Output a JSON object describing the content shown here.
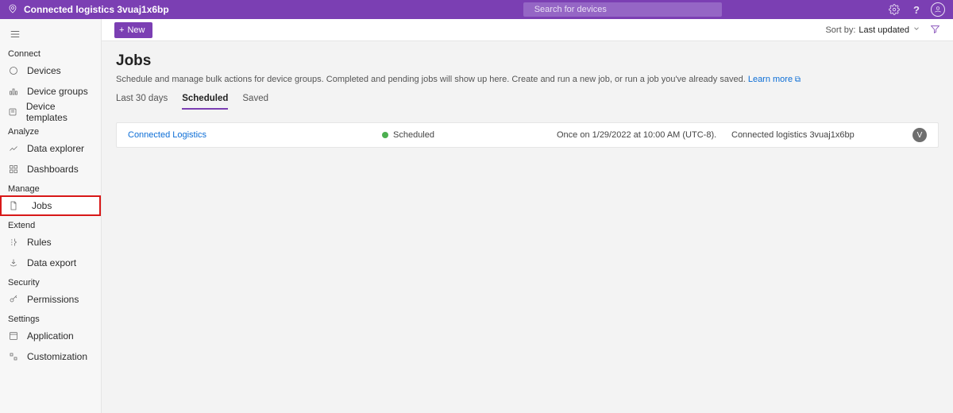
{
  "header": {
    "app_title": "Connected logistics 3vuaj1x6bp",
    "search_placeholder": "Search for devices"
  },
  "sidebar": {
    "groups": [
      {
        "label": "Connect",
        "items": [
          {
            "icon": "devices",
            "label": "Devices"
          },
          {
            "icon": "device-groups",
            "label": "Device groups"
          },
          {
            "icon": "templates",
            "label": "Device templates"
          }
        ]
      },
      {
        "label": "Analyze",
        "items": [
          {
            "icon": "explorer",
            "label": "Data explorer"
          },
          {
            "icon": "dashboards",
            "label": "Dashboards"
          }
        ]
      },
      {
        "label": "Manage",
        "items": [
          {
            "icon": "jobs",
            "label": "Jobs",
            "selected": true
          }
        ]
      },
      {
        "label": "Extend",
        "items": [
          {
            "icon": "rules",
            "label": "Rules"
          },
          {
            "icon": "export",
            "label": "Data export"
          }
        ]
      },
      {
        "label": "Security",
        "items": [
          {
            "icon": "permissions",
            "label": "Permissions"
          }
        ]
      },
      {
        "label": "Settings",
        "items": [
          {
            "icon": "application",
            "label": "Application"
          },
          {
            "icon": "customization",
            "label": "Customization"
          }
        ]
      }
    ]
  },
  "commandbar": {
    "new_label": "New",
    "sort_prefix": "Sort by:",
    "sort_value": "Last updated"
  },
  "page": {
    "title": "Jobs",
    "description_text": "Schedule and manage bulk actions for device groups. Completed and pending jobs will show up here. Create and run a new job, or run a job you've already saved. ",
    "learn_more_label": "Learn more"
  },
  "tabs": [
    {
      "label": "Last 30 days",
      "active": false
    },
    {
      "label": "Scheduled",
      "active": true
    },
    {
      "label": "Saved",
      "active": false
    }
  ],
  "jobs": [
    {
      "name": "Connected Logistics",
      "status": "Scheduled",
      "schedule": "Once on 1/29/2022 at 10:00 AM (UTC-8).",
      "app": "Connected logistics 3vuaj1x6bp",
      "avatar_initial": "V"
    }
  ]
}
